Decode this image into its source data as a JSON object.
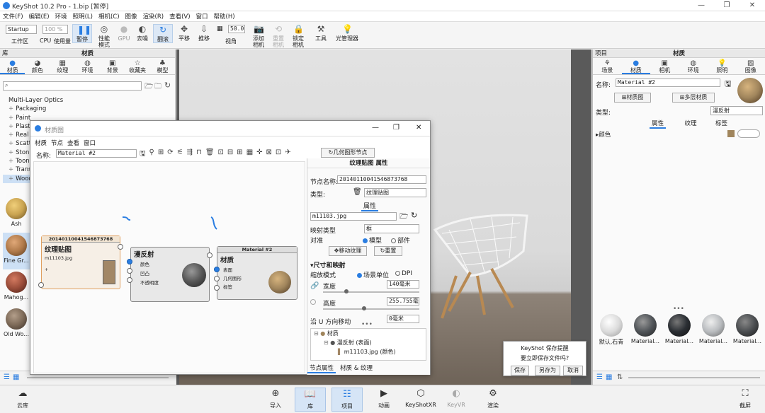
{
  "window": {
    "title": "KeyShot 10.2 Pro - 1.bip [暂停]",
    "btn_min": "—",
    "btn_max": "❐",
    "btn_close": "✕"
  },
  "menu": [
    "文件(F)",
    "编辑(E)",
    "环境",
    "照明(L)",
    "相机(C)",
    "图像",
    "渲染(R)",
    "查看(V)",
    "窗口",
    "帮助(H)"
  ],
  "toolbar": {
    "workspace": "Startup",
    "zoom": "100 %",
    "workspace_label": "工作区",
    "cpu_label": "CPU",
    "cpu_usage_label": "使用量",
    "pause_label": "暂停",
    "perf_label": "性能\n模式",
    "gpu_label": "GPU",
    "denoise_label": "去噪",
    "tumble_label": "翻滚",
    "pan_label": "平移",
    "dolly_label": "推移",
    "fov_value": "50.0",
    "fov_label": "视角",
    "add_camera_label": "添加\n相机",
    "reset_camera_label": "重置\n相机",
    "lock_camera_label": "锁定\n相机",
    "tools_label": "工具",
    "light_manager_label": "光管理器"
  },
  "left": {
    "panel_label": "库",
    "title": "材质",
    "tabs": [
      "材质",
      "颜色",
      "纹理",
      "环境",
      "背景",
      "收藏夹",
      "模型"
    ],
    "tree": [
      "Multi-Layer Optics",
      "Packaging",
      "Paint",
      "Plastic",
      "Real Cloth",
      "Scattering",
      "Stone",
      "Toon",
      "Translucent",
      "Wood"
    ],
    "swatches": [
      {
        "label": "Ash",
        "color": "#c9a350"
      },
      {
        "label": "Fine Gr...",
        "color": "#b07a4a"
      },
      {
        "label": "Mahog...",
        "color": "#9a4d3a"
      },
      {
        "label": "Old Wo...",
        "color": "#7d6a58"
      }
    ]
  },
  "dialog": {
    "title": "材质图",
    "menu": [
      "材质",
      "节点",
      "查看",
      "窗口"
    ],
    "name_label": "名称:",
    "name_value": "Material #2",
    "geo_node_label": "几何图形节点",
    "node_texture": {
      "header": "20140110041546873768",
      "title": "纹理贴图",
      "file": "m11103.jpg"
    },
    "node_diffuse": {
      "title": "漫反射",
      "ports": [
        "颜色",
        "凹凸",
        "不透明度"
      ]
    },
    "node_material": {
      "header": "Material #2",
      "title": "材质",
      "ports": [
        "表面",
        "几何图形",
        "标签"
      ]
    },
    "props": {
      "title": "纹理贴图 属性",
      "node_name_label": "节点名称:",
      "node_name": "20140110041546873768",
      "type_label": "类型:",
      "type_value": "纹理贴图",
      "attr_tab": "属性",
      "file": "m11103.jpg",
      "mapping_label": "映射类型",
      "mapping_value": "框",
      "align_label": "对准",
      "align_model": "模型",
      "align_part": "部件",
      "move_texture": "移动纹理",
      "reset": "重置",
      "size_section": "尺寸和映射",
      "scale_mode_label": "缩放模式",
      "scale_scene": "场景单位",
      "scale_dpi": "DPI",
      "width_label": "宽度",
      "width_value": "140毫米",
      "height_label": "高度",
      "height_value": "255.755毫米",
      "shift_u_label": "沿 U 方向移动",
      "shift_u_value": "0毫米",
      "tree": [
        "材质",
        "漫反射 (表面)",
        "m11103.jpg (颜色)"
      ],
      "bottom_tabs": [
        "节点属性",
        "材质 & 纹理"
      ]
    }
  },
  "right": {
    "panel_label": "项目",
    "title": "材质",
    "tabs": [
      "场景",
      "材质",
      "相机",
      "环境",
      "照明",
      "图像"
    ],
    "name_label": "名称:",
    "name_value": "Material #2",
    "graph_btn": "材质图",
    "multilayer_btn": "多层材质",
    "type_label": "类型:",
    "type_value": "漫反射",
    "subtabs": [
      "属性",
      "纹理",
      "标签"
    ],
    "color_label": "颜色",
    "color_swatch": "#a0855c",
    "mats": [
      {
        "label": "默认,石青",
        "color": "#dcdcdc"
      },
      {
        "label": "Material...",
        "color": "#505458"
      },
      {
        "label": "Material...",
        "color": "#2a2e33"
      },
      {
        "label": "Material...",
        "color": "#b9bcbf"
      },
      {
        "label": "Material...",
        "color": "#4a4d50"
      }
    ]
  },
  "save": {
    "title": "KeyShot 保存提醒",
    "text": "要立即保存文件吗?",
    "save": "保存",
    "saveas": "另存为",
    "cancel": "取消"
  },
  "bottom": [
    {
      "label": "云库",
      "icon": "cloud-icon"
    },
    {
      "label": "导入",
      "icon": "import-icon"
    },
    {
      "label": "库",
      "icon": "library-icon"
    },
    {
      "label": "项目",
      "icon": "project-icon"
    },
    {
      "label": "动画",
      "icon": "animation-icon"
    },
    {
      "label": "KeyShotXR",
      "icon": "xr-icon"
    },
    {
      "label": "KeyVR",
      "icon": "vr-icon"
    },
    {
      "label": "渲染",
      "icon": "render-icon"
    },
    {
      "label": "截屏",
      "icon": "screenshot-icon"
    }
  ]
}
